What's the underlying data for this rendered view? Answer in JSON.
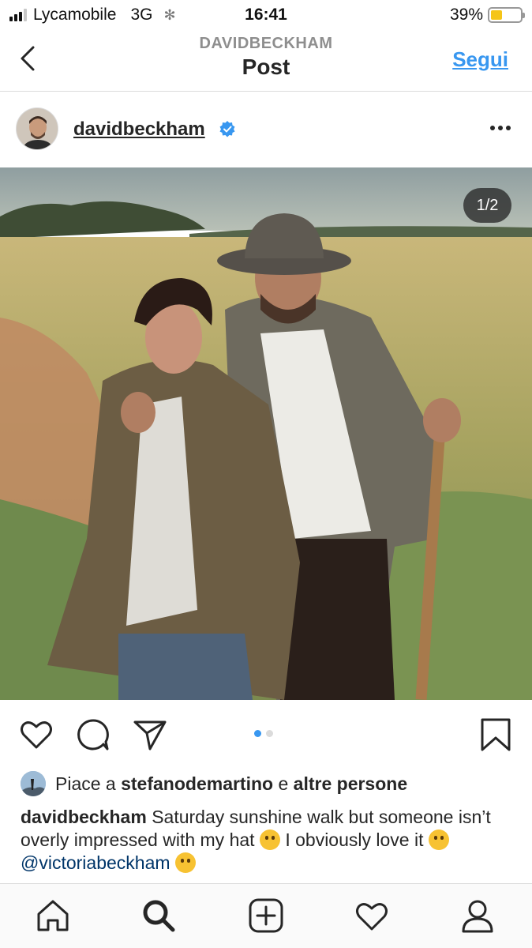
{
  "status_bar": {
    "carrier": "Lycamobile",
    "network": "3G",
    "time": "16:41",
    "battery_percent": "39%",
    "battery_level": 0.39,
    "signal_bars": 3
  },
  "header": {
    "subtitle": "DAVIDBECKHAM",
    "title": "Post",
    "follow_label": "Segui",
    "back_icon": "chevron-left-icon"
  },
  "post": {
    "username": "davidbeckham",
    "verified": true,
    "photo_counter": "1/2",
    "carousel_index": 1,
    "carousel_total": 2
  },
  "actions": {
    "icons": [
      "heart-icon",
      "comment-icon",
      "share-icon",
      "bookmark-icon"
    ]
  },
  "likes": {
    "prefix": "Piace a",
    "user": "stefanodemartino",
    "middle": "e",
    "rest": "altre persone"
  },
  "caption": {
    "username": "davidbeckham",
    "text_1": "Saturday sunshine walk but someone isn’t overly impressed with my hat",
    "text_2": "I obviously love it",
    "mention": "@victoriabeckham"
  },
  "tab_bar": {
    "icons": [
      "home-icon",
      "search-icon",
      "new-post-icon",
      "activity-icon",
      "profile-icon"
    ],
    "active": "search-icon"
  },
  "colors": {
    "accent": "#3897f0",
    "text": "#262626",
    "muted": "#8e8e8e",
    "divider": "#dbdbdb",
    "battery": "#f5c518"
  }
}
